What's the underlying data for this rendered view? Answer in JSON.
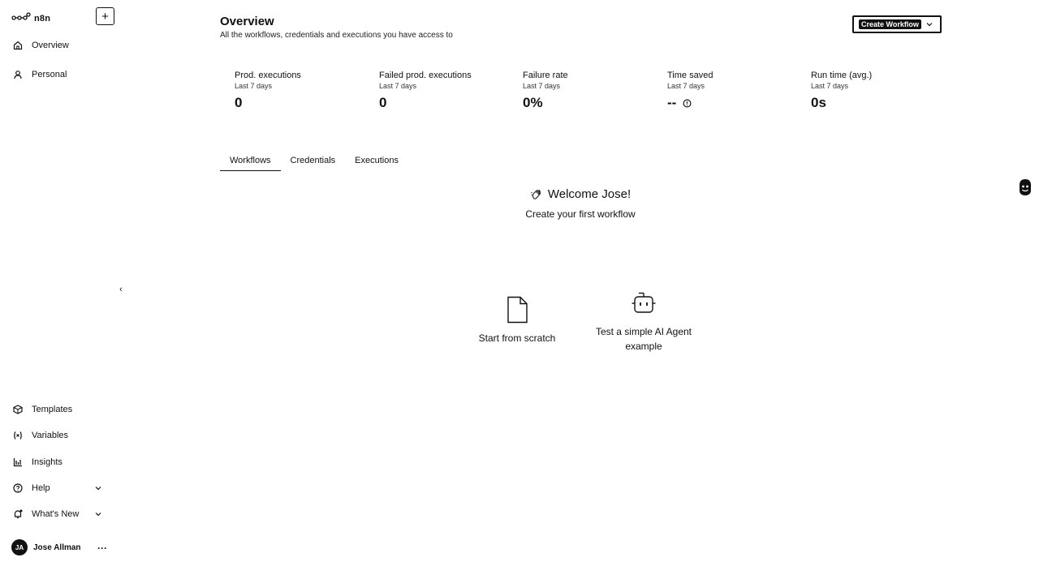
{
  "app": {
    "logo_text": "n8n"
  },
  "sidebar": {
    "add_label": "+",
    "nav": [
      {
        "label": "Overview",
        "icon": "home-icon"
      },
      {
        "label": "Personal",
        "icon": "user-icon"
      }
    ],
    "bottom": [
      {
        "label": "Templates",
        "icon": "box-icon"
      },
      {
        "label": "Variables",
        "icon": "variable-icon"
      },
      {
        "label": "Insights",
        "icon": "bar-chart-icon"
      },
      {
        "label": "Help",
        "icon": "help-circle-icon"
      },
      {
        "label": "What's New",
        "icon": "bell-icon"
      }
    ],
    "collapse_label": "‹",
    "user": {
      "initials": "JA",
      "name": "Jose Allman",
      "more": "···"
    }
  },
  "header": {
    "title": "Overview",
    "subtitle": "All the workflows, credentials and executions you have access to",
    "create_button": "Create Workflow"
  },
  "metrics": [
    {
      "label": "Prod. executions",
      "sub": "Last 7 days",
      "value": "0"
    },
    {
      "label": "Failed prod. executions",
      "sub": "Last 7 days",
      "value": "0"
    },
    {
      "label": "Failure rate",
      "sub": "Last 7 days",
      "value": "0%"
    },
    {
      "label": "Time saved",
      "sub": "Last 7 days",
      "value": "--"
    },
    {
      "label": "Run time (avg.)",
      "sub": "Last 7 days",
      "value": "0s"
    }
  ],
  "tabs": [
    {
      "label": "Workflows",
      "active": true
    },
    {
      "label": "Credentials",
      "active": false
    },
    {
      "label": "Executions",
      "active": false
    }
  ],
  "empty_state": {
    "title": "Welcome Jose!",
    "subtitle": "Create your first workflow"
  },
  "cards": [
    {
      "label": "Start from scratch",
      "icon": "file-icon"
    },
    {
      "label": "Test a simple AI Agent example",
      "icon": "robot-icon"
    }
  ]
}
